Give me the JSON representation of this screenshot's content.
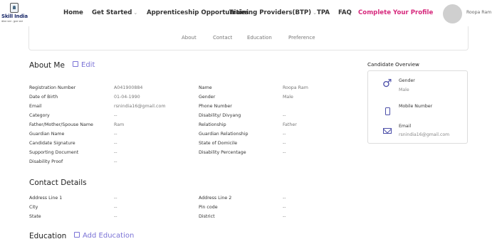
{
  "brand": {
    "name": "Skill India",
    "tagline": "कौशल भारत - कुशल भारत"
  },
  "nav": {
    "home": "Home",
    "get_started": "Get Started",
    "apprenticeship": "Apprenticeship Opportunities",
    "training_providers": "Training Providers(BTP)",
    "tpa": "TPA",
    "faq": "FAQ",
    "complete_profile": "Complete Your Profile",
    "chevron": "⌄"
  },
  "user": {
    "display_name": "Roopa Ram"
  },
  "tabs": [
    "About",
    "Contact",
    "Education",
    "Preference"
  ],
  "about": {
    "title": "About Me",
    "edit_label": "Edit",
    "left": [
      {
        "label": "Registration Number",
        "value": "A041900884"
      },
      {
        "label": "Date of Birth",
        "value": "01-04-1990"
      },
      {
        "label": "Email",
        "value": "rsnindia16@gmail.com"
      },
      {
        "label": "Category",
        "value": "--"
      },
      {
        "label": "Father/Mother/Spouse Name",
        "value": "Ram"
      },
      {
        "label": "Guardian Name",
        "value": "--"
      },
      {
        "label": "Candidate Signature",
        "value": "--"
      },
      {
        "label": "Supporting Document",
        "value": "--"
      },
      {
        "label": "Disability Proof",
        "value": "--"
      }
    ],
    "right": [
      {
        "label": "Name",
        "value": "Roopa Ram"
      },
      {
        "label": "Gender",
        "value": "Male"
      },
      {
        "label": "Phone Number",
        "value": ""
      },
      {
        "label": "Disability/ Divyang",
        "value": "--"
      },
      {
        "label": "Relationship",
        "value": "Father"
      },
      {
        "label": "Guardian Relationship",
        "value": "--"
      },
      {
        "label": "State of Domicile",
        "value": "--"
      },
      {
        "label": "Disability Percentage",
        "value": "--"
      }
    ]
  },
  "contact": {
    "title": "Contact Details",
    "left": [
      {
        "label": "Address Line 1",
        "value": "--"
      },
      {
        "label": "City",
        "value": "--"
      },
      {
        "label": "State",
        "value": "--"
      }
    ],
    "right": [
      {
        "label": "Address Line 2",
        "value": "--"
      },
      {
        "label": "Pin code",
        "value": "--"
      },
      {
        "label": "District",
        "value": "--"
      }
    ]
  },
  "education": {
    "title": "Education",
    "add_label": "Add Education"
  },
  "overview": {
    "title": "Candidate Overview",
    "gender_label": "Gender",
    "gender_value": "Male",
    "mobile_label": "Mobile Number",
    "email_label": "Email",
    "email_value": "rsnindia16@gmail.com",
    "gender_glyph": "♂"
  },
  "colors": {
    "accent": "#7b73d6",
    "profile_link": "#d6287c",
    "icon": "#4b4ea8"
  },
  "icons": [
    "skill-india-logo",
    "chevron-down-icon",
    "edit-icon",
    "male-icon",
    "phone-icon",
    "mail-icon"
  ]
}
